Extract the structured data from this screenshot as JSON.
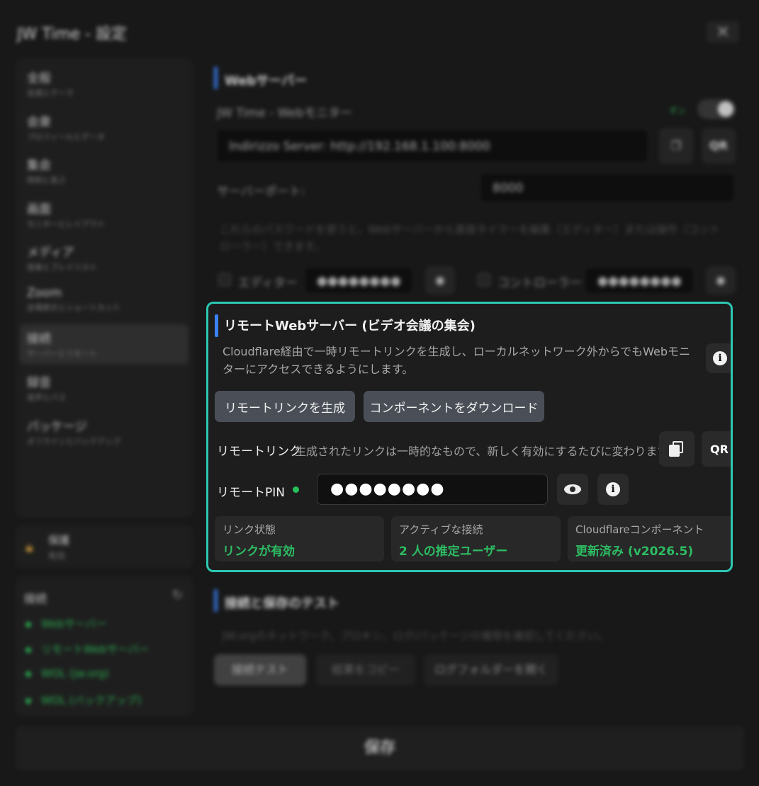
{
  "window": {
    "title": "JW Time - 設定",
    "close_glyph": "✕"
  },
  "sidebar": {
    "items": [
      {
        "label": "全般",
        "sub": "言語とテーマ"
      },
      {
        "label": "会衆",
        "sub": "プロフィールとデータ"
      },
      {
        "label": "集会",
        "sub": "時刻と長さ"
      },
      {
        "label": "画面",
        "sub": "モニターとレイアウト"
      },
      {
        "label": "メディア",
        "sub": "音楽とプレイリスト"
      },
      {
        "label": "Zoom",
        "sub": "会場表示とショートカット"
      },
      {
        "label": "接続",
        "sub": "サーバーとリモート",
        "active": true
      },
      {
        "label": "録音",
        "sub": "音声とパス"
      },
      {
        "label": "パッケージ",
        "sub": "オフラインとバックアップ"
      }
    ],
    "protection": {
      "label": "保護",
      "status": "有効",
      "icon": "lock-icon"
    },
    "connections": {
      "title": "接続",
      "items": [
        "Webサーバー",
        "リモートWebサーバー",
        "WOL (jw.org)",
        "WOL (バックアップ)"
      ]
    }
  },
  "web_server": {
    "title": "Webサーバー",
    "monitor_label": "JW Time - Webモニター",
    "toggle_state": "オン",
    "address": "Indirizzo Server: http://192.168.1.100:8000",
    "qr_label": "QR",
    "port_label": "サーバーポート:",
    "port_value": "8000",
    "password_note": "これらのパスワードを使うと、Webサーバーから直接タイマーを編集（エディター）または操作（コントローラー）できます。",
    "editor_label": "エディター",
    "editor_password": "●●●●●●●●",
    "controller_label": "コントローラー",
    "controller_password": "●●●●●●●●"
  },
  "remote": {
    "title": "リモートWebサーバー (ビデオ会議の集会)",
    "description": "Cloudflare経由で一時リモートリンクを生成し、ローカルネットワーク外からでもWebモニターにアクセスできるようにします。",
    "generate_button": "リモートリンクを生成",
    "download_button": "コンポーネントをダウンロード",
    "link_label": "リモートリンク",
    "link_hint": "生成されたリンクは一時的なもので、新しく有効にするたびに変わります。",
    "qr_label": "QR",
    "pin_label": "リモートPIN",
    "pin_value": "●●●●●●●●",
    "stats": [
      {
        "label": "リンク状態",
        "value": "リンクが有効"
      },
      {
        "label": "アクティブな接続",
        "value": "2 人の推定ユーザー"
      },
      {
        "label": "Cloudflareコンポーネント",
        "value": "更新済み (v2026.5)"
      }
    ],
    "accent_color": "#2cc7b2",
    "status_color": "#2dbd63"
  },
  "test": {
    "title": "接続と保存のテスト",
    "description": "JW.orgのネットワーク、プロキシ、ログ/パッケージの権限を確認してください。",
    "buttons": [
      "接続テスト",
      "結果をコピー",
      "ログフォルダーを開く"
    ]
  },
  "footer": {
    "save_label": "保存"
  }
}
